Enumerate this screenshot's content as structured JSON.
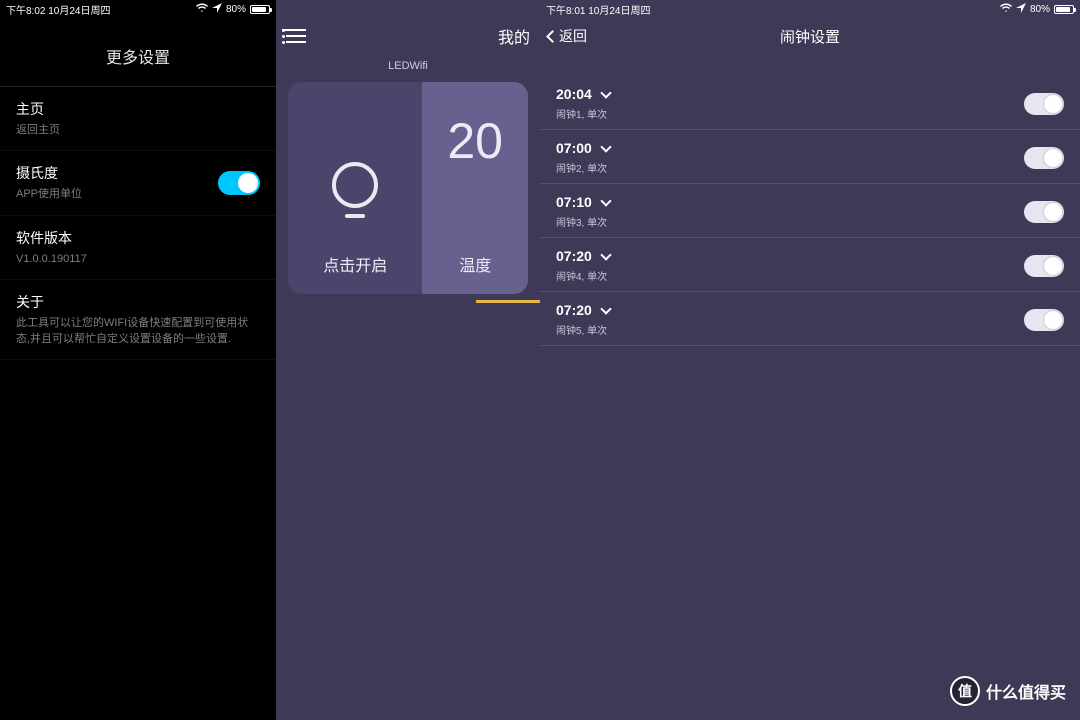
{
  "statusbar": {
    "left_a": "下午8:02   10月24日周四",
    "left_b": "下午8:01   10月24日周四",
    "battery": "80%"
  },
  "settings": {
    "title": "更多设置",
    "home": {
      "label": "主页",
      "sub": "返回主页"
    },
    "celsius": {
      "label": "摄氏度",
      "sub": "APP使用单位",
      "on": true
    },
    "version": {
      "label": "软件版本",
      "value": "V1.0.0.190117"
    },
    "about": {
      "label": "关于",
      "sub": "此工具可以让您的WIFI设备快速配置到可使用状态,并且可以帮忙自定义设置设备的一些设置."
    }
  },
  "dash": {
    "title": "我的",
    "tab": "LEDWifi",
    "light_label": "点击开启",
    "temp_value": "20",
    "temp_label": "温度"
  },
  "alarms": {
    "back": "返回",
    "title": "闹钟设置",
    "list": [
      {
        "time": "20:04",
        "sub": "闹钟1, 单次",
        "on": false
      },
      {
        "time": "07:00",
        "sub": "闹钟2, 单次",
        "on": false
      },
      {
        "time": "07:10",
        "sub": "闹钟3, 单次",
        "on": false
      },
      {
        "time": "07:20",
        "sub": "闹钟4, 单次",
        "on": false
      },
      {
        "time": "07:20",
        "sub": "闹钟5, 单次",
        "on": false
      }
    ]
  },
  "watermark": {
    "badge": "值",
    "text": "什么值得买"
  }
}
